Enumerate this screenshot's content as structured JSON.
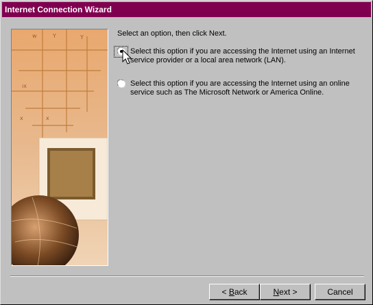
{
  "window": {
    "title": "Internet Connection Wizard",
    "titlebar_color": "#800050"
  },
  "content": {
    "prompt": "Select an option, then click Next.",
    "options": [
      {
        "label": "Select this option if you are accessing the Internet using an Internet service provider or a local area network (LAN).",
        "selected": true
      },
      {
        "label": "Select this option if you are accessing the Internet using an online service such as The Microsoft Network or America Online.",
        "selected": false
      }
    ]
  },
  "buttons": {
    "back": {
      "prefix": "< ",
      "key": "B",
      "rest": "ack"
    },
    "next": {
      "prefix": "",
      "key": "N",
      "rest": "ext >"
    },
    "cancel": {
      "label": "Cancel"
    }
  },
  "icons": [
    "radio-selected-icon",
    "radio-unselected-icon",
    "mouse-cursor-icon",
    "wizard-artwork"
  ]
}
